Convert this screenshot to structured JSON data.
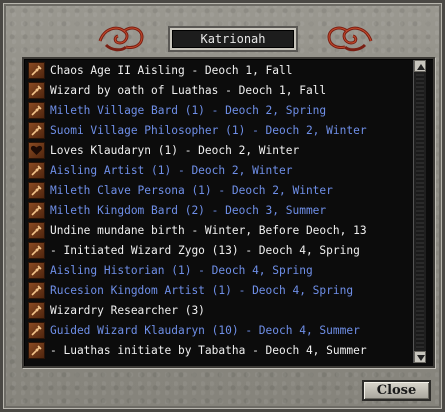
{
  "window": {
    "title": "Katrionah"
  },
  "legend_marks": [
    {
      "text": "Chaos Age II Aisling - Deoch 1, Fall",
      "color": "white",
      "icon": "staff-icon"
    },
    {
      "text": "Wizard by oath of Luathas - Deoch 1, Fall",
      "color": "white",
      "icon": "staff-icon"
    },
    {
      "text": "Mileth Village Bard (1) - Deoch 2, Spring",
      "color": "blue",
      "icon": "staff-icon"
    },
    {
      "text": "Suomi Village Philosopher (1) - Deoch 2, Winter",
      "color": "blue",
      "icon": "staff-icon"
    },
    {
      "text": "Loves Klaudaryn (1) - Deoch 2, Winter",
      "color": "white",
      "icon": "heart-icon"
    },
    {
      "text": "Aisling Artist (1) - Deoch 2, Winter",
      "color": "blue",
      "icon": "staff-icon"
    },
    {
      "text": "Mileth Clave Persona (1) - Deoch 2, Winter",
      "color": "blue",
      "icon": "staff-icon"
    },
    {
      "text": "Mileth Kingdom Bard (2) - Deoch 3, Summer",
      "color": "blue",
      "icon": "staff-icon"
    },
    {
      "text": "Undine mundane birth - Winter, Before Deoch, 13",
      "color": "white",
      "icon": "staff-icon"
    },
    {
      "text": "- Initiated Wizard Zygo (13) - Deoch 4, Spring",
      "color": "white",
      "icon": "staff-icon"
    },
    {
      "text": "Aisling Historian (1) - Deoch 4, Spring",
      "color": "blue",
      "icon": "staff-icon"
    },
    {
      "text": "Rucesion Kingdom Artist (1) - Deoch 4, Spring",
      "color": "blue",
      "icon": "staff-icon"
    },
    {
      "text": "Wizardry Researcher (3)",
      "color": "white",
      "icon": "staff-icon"
    },
    {
      "text": "Guided Wizard Klaudaryn (10) - Deoch 4, Summer",
      "color": "blue",
      "icon": "staff-icon"
    },
    {
      "text": "- Luathas initiate by Tabatha - Deoch 4, Summer",
      "color": "white",
      "icon": "staff-icon"
    }
  ],
  "buttons": {
    "close_label": "Close"
  },
  "colors": {
    "white_text": "#f0f0f0",
    "blue_text": "#6f8fe8",
    "list_background": "#0c0c0c",
    "frame_stone": "#8c8a82"
  }
}
